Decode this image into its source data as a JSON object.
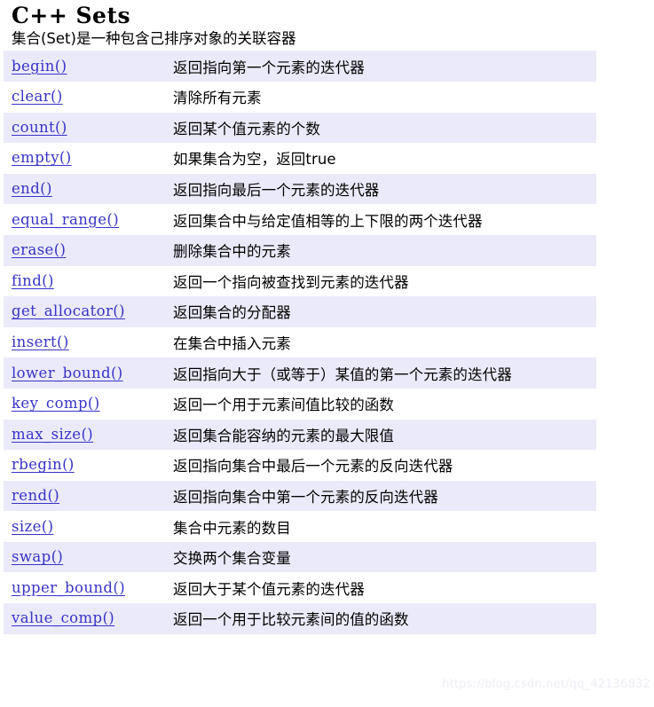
{
  "header": {
    "title": "C++ Sets",
    "subtitle": "集合(Set)是一种包含己排序对象的关联容器"
  },
  "colors": {
    "link": "#3734c8",
    "row_shaded": "#ebeafa",
    "row_plain": "#ffffff",
    "text": "#000000",
    "watermark": "#eeeef7"
  },
  "watermark": {
    "text": "https://blog.csdn.net/qq_42136832"
  },
  "table": {
    "rows": [
      {
        "name": "begin()",
        "desc": "返回指向第一个元素的迭代器",
        "shaded": true,
        "tight": false
      },
      {
        "name": "clear()",
        "desc": "清除所有元素",
        "shaded": false,
        "tight": false
      },
      {
        "name": "count()",
        "desc": "返回某个值元素的个数",
        "shaded": true,
        "tight": false
      },
      {
        "name": "empty()",
        "desc": "如果集合为空，返回true",
        "shaded": false,
        "tight": false
      },
      {
        "name": "end()",
        "desc": "返回指向最后一个元素的迭代器",
        "shaded": true,
        "tight": false
      },
      {
        "name": "equal_range()",
        "desc": "返回集合中与给定值相等的上下限的两个迭代器",
        "shaded": false,
        "tight": false
      },
      {
        "name": "erase()",
        "desc": "删除集合中的元素",
        "shaded": true,
        "tight": false
      },
      {
        "name": "find()",
        "desc": "返回一个指向被查找到元素的迭代器",
        "shaded": false,
        "tight": false
      },
      {
        "name": "get_allocator()",
        "desc": "返回集合的分配器",
        "shaded": true,
        "tight": true
      },
      {
        "name": "insert()",
        "desc": "在集合中插入元素",
        "shaded": false,
        "tight": false
      },
      {
        "name": "lower_bound()",
        "desc": "返回指向大于（或等于）某值的第一个元素的迭代器",
        "shaded": true,
        "tight": false
      },
      {
        "name": "key_comp()",
        "desc": "返回一个用于元素间值比较的函数",
        "shaded": false,
        "tight": false
      },
      {
        "name": "max_size()",
        "desc": "返回集合能容纳的元素的最大限值",
        "shaded": true,
        "tight": false
      },
      {
        "name": "rbegin()",
        "desc": "返回指向集合中最后一个元素的反向迭代器",
        "shaded": false,
        "tight": false
      },
      {
        "name": "rend()",
        "desc": "返回指向集合中第一个元素的反向迭代器",
        "shaded": true,
        "tight": false
      },
      {
        "name": "size()",
        "desc": "集合中元素的数目",
        "shaded": false,
        "tight": false
      },
      {
        "name": "swap()",
        "desc": "交换两个集合变量",
        "shaded": true,
        "tight": false
      },
      {
        "name": "upper_bound()",
        "desc": "返回大于某个值元素的迭代器",
        "shaded": false,
        "tight": false
      },
      {
        "name": "value_comp()",
        "desc": "返回一个用于比较元素间的值的函数",
        "shaded": true,
        "tight": false
      }
    ]
  }
}
